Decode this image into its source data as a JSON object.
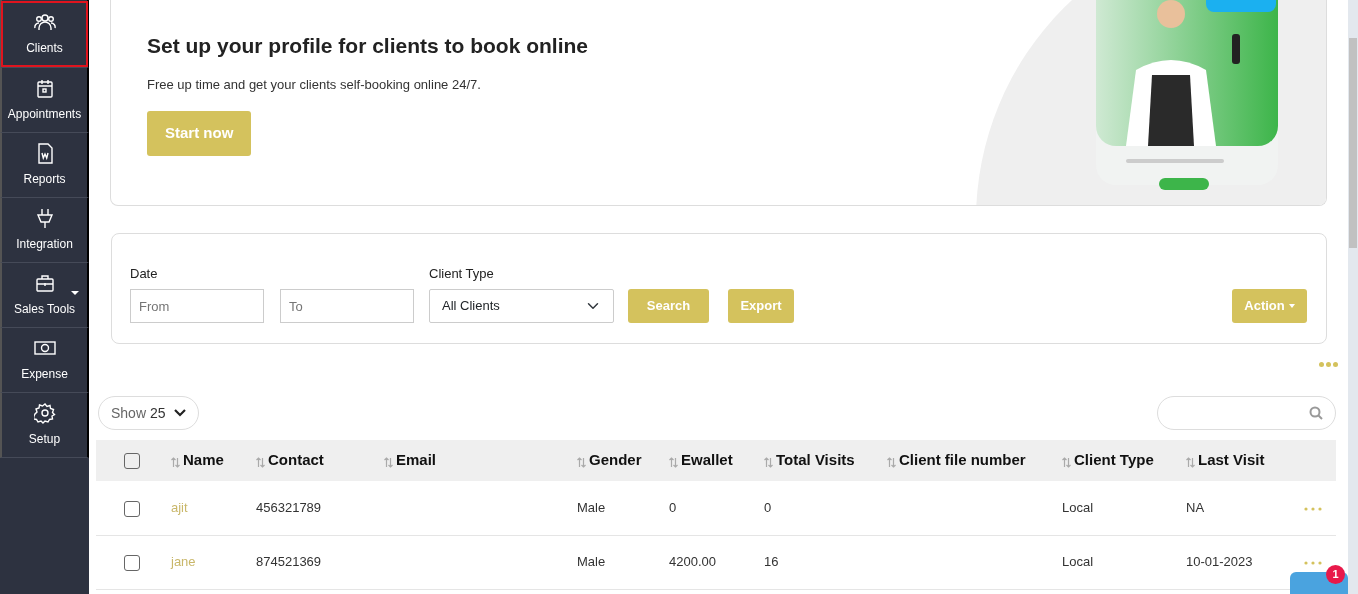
{
  "sidebar": {
    "items": [
      {
        "label": "Clients",
        "kind": "people",
        "selected": true,
        "has_dropdown": false
      },
      {
        "label": "Appointments",
        "kind": "calendar",
        "selected": false,
        "has_dropdown": false
      },
      {
        "label": "Reports",
        "kind": "document",
        "selected": false,
        "has_dropdown": false
      },
      {
        "label": "Integration",
        "kind": "plug",
        "selected": false,
        "has_dropdown": false
      },
      {
        "label": "Sales Tools",
        "kind": "briefcase",
        "selected": false,
        "has_dropdown": true
      },
      {
        "label": "Expense",
        "kind": "money",
        "selected": false,
        "has_dropdown": false
      },
      {
        "label": "Setup",
        "kind": "gear",
        "selected": false,
        "has_dropdown": false
      }
    ]
  },
  "banner": {
    "title": "Set up your profile for clients to book online",
    "text": "Free up time and get your clients self-booking online 24/7.",
    "button": "Start now"
  },
  "filters": {
    "date_label": "Date",
    "from_placeholder": "From",
    "to_placeholder": "To",
    "client_type_label": "Client Type",
    "client_type_value": "All Clients",
    "search_button": "Search",
    "export_button": "Export",
    "action_button": "Action"
  },
  "table_controls": {
    "show_label": "Show",
    "page_size": "25"
  },
  "table": {
    "columns": [
      "Name",
      "Contact",
      "Email",
      "Gender",
      "Ewallet",
      "Total Visits",
      "Client file number",
      "Client Type",
      "Last Visit"
    ],
    "select_all_checked": false,
    "rows": [
      {
        "checked": false,
        "cells": [
          "ajit",
          "456321789",
          "",
          "Male",
          "0",
          "0",
          "",
          "Local",
          "NA"
        ]
      },
      {
        "checked": false,
        "cells": [
          "jane",
          "874521369",
          "",
          "Male",
          "4200.00",
          "16",
          "",
          "Local",
          "10-01-2023"
        ]
      }
    ]
  },
  "chat_widget": {
    "badge": "1"
  }
}
